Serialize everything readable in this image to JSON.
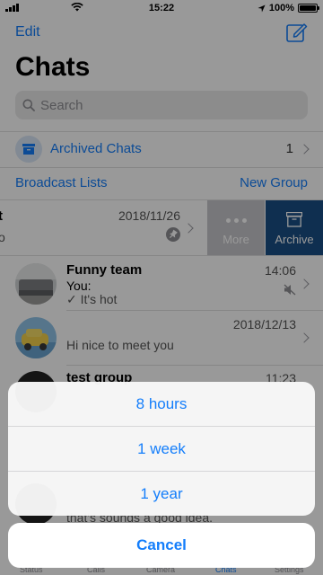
{
  "status_bar": {
    "time": "15:22",
    "battery": "100%",
    "battery_level": 1.0
  },
  "nav": {
    "edit_label": "Edit",
    "title": "Chats"
  },
  "search": {
    "placeholder": "Search"
  },
  "archived": {
    "label": "Archived Chats",
    "count": "1"
  },
  "links": {
    "broadcast": "Broadcast Lists",
    "new_group": "New Group"
  },
  "swiped_row": {
    "name_fragment": "t",
    "msg_fragment": "o",
    "date": "2018/11/26",
    "more_label": "More",
    "archive_label": "Archive"
  },
  "chats": [
    {
      "name": "Funny team",
      "time": "14:06",
      "line1": "You:",
      "line2": "✓ It's hot",
      "muted": true
    },
    {
      "name": "",
      "time": "2018/12/13",
      "line1": "Hi nice to meet you",
      "line2": ""
    },
    {
      "name": "test group",
      "time": "11:23",
      "line1": "",
      "line2": ""
    },
    {
      "name": "",
      "time": "",
      "line1": "that's sounds a good idea.",
      "line2": ""
    }
  ],
  "tabs": [
    "Status",
    "Calls",
    "Camera",
    "Chats",
    "Settings"
  ],
  "active_tab": "Chats",
  "action_sheet": {
    "options": [
      "8 hours",
      "1 week",
      "1 year"
    ],
    "cancel_label": "Cancel"
  },
  "colors": {
    "accent": "#147efb",
    "archive": "#1a4f86",
    "more": "#c7c7cc"
  }
}
